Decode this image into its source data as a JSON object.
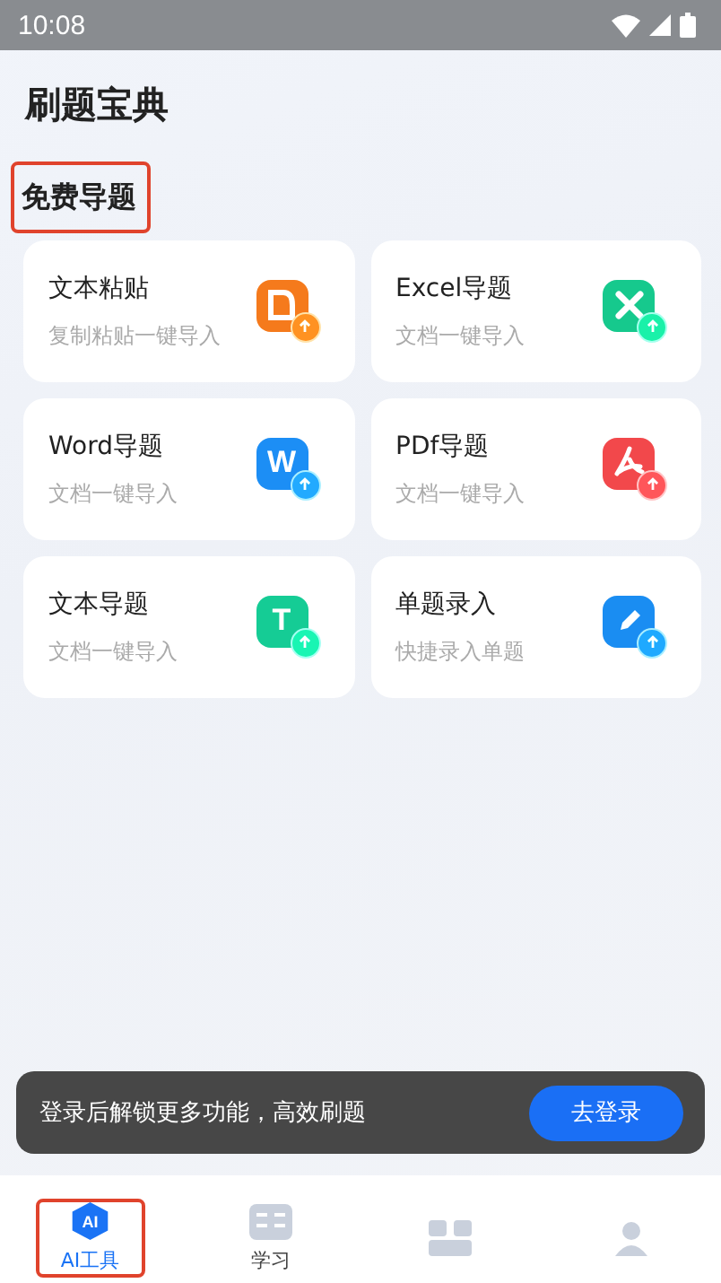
{
  "status_bar": {
    "time": "10:08"
  },
  "app_title": "刷题宝典",
  "section": {
    "title": "免费导题",
    "highlighted": true
  },
  "cards": [
    {
      "title": "文本粘贴",
      "subtitle": "复制粘贴一键导入",
      "kind": "paste",
      "color": "#f57a1c"
    },
    {
      "title": "Excel导题",
      "subtitle": "文档一键导入",
      "kind": "excel",
      "color": "#16c98d"
    },
    {
      "title": "Word导题",
      "subtitle": "文档一键导入",
      "kind": "word",
      "color": "#1c8ef5",
      "glyph": "W"
    },
    {
      "title": "PDf导题",
      "subtitle": "文档一键导入",
      "kind": "pdf",
      "color": "#f2484b"
    },
    {
      "title": "文本导题",
      "subtitle": "文档一键导入",
      "kind": "text",
      "color": "#15cc95",
      "glyph": "T"
    },
    {
      "title": "单题录入",
      "subtitle": "快捷录入单题",
      "kind": "edit",
      "color": "#1a8df2"
    }
  ],
  "login_bar": {
    "message": "登录后解锁更多功能，高效刷题",
    "button": "去登录"
  },
  "tabs": [
    {
      "label": "AI工具",
      "kind": "ai",
      "glyph": "AI",
      "selected": true,
      "highlighted": true
    },
    {
      "label": "学习",
      "kind": "book",
      "selected": false,
      "highlighted": false
    },
    {
      "kind": "grid",
      "selected": false,
      "highlighted": false
    },
    {
      "kind": "person",
      "selected": false,
      "highlighted": false
    }
  ]
}
